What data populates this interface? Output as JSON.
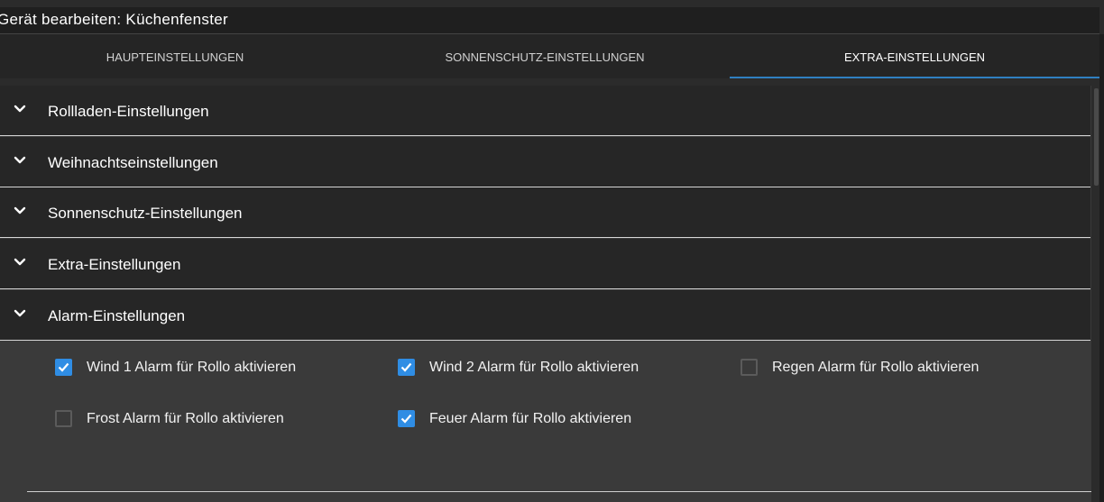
{
  "dialog": {
    "title": "Gerät bearbeiten: Küchenfenster"
  },
  "tabs": [
    {
      "label": "HAUPTEINSTELLUNGEN",
      "active": false
    },
    {
      "label": "SONNENSCHUTZ-EINSTELLUNGEN",
      "active": false
    },
    {
      "label": "EXTRA-EINSTELLUNGEN",
      "active": true
    }
  ],
  "sections": [
    {
      "label": "Rollladen-Einstellungen",
      "expanded": false
    },
    {
      "label": "Weihnachtseinstellungen",
      "expanded": false
    },
    {
      "label": "Sonnenschutz-Einstellungen",
      "expanded": false
    },
    {
      "label": "Extra-Einstellungen",
      "expanded": false
    },
    {
      "label": "Alarm-Einstellungen",
      "expanded": true
    }
  ],
  "alarm_options": [
    {
      "label": "Wind 1 Alarm für Rollo aktivieren",
      "checked": true
    },
    {
      "label": "Wind 2 Alarm für Rollo aktivieren",
      "checked": true
    },
    {
      "label": "Regen Alarm für Rollo aktivieren",
      "checked": false
    },
    {
      "label": "Frost Alarm für Rollo aktivieren",
      "checked": false
    },
    {
      "label": "Feuer Alarm für Rollo aktivieren",
      "checked": true
    }
  ],
  "colors": {
    "accent": "#2f8de4",
    "tab_indicator": "#2f7fc1",
    "header_bg": "#262626",
    "content_bg": "#3a3a3a"
  }
}
